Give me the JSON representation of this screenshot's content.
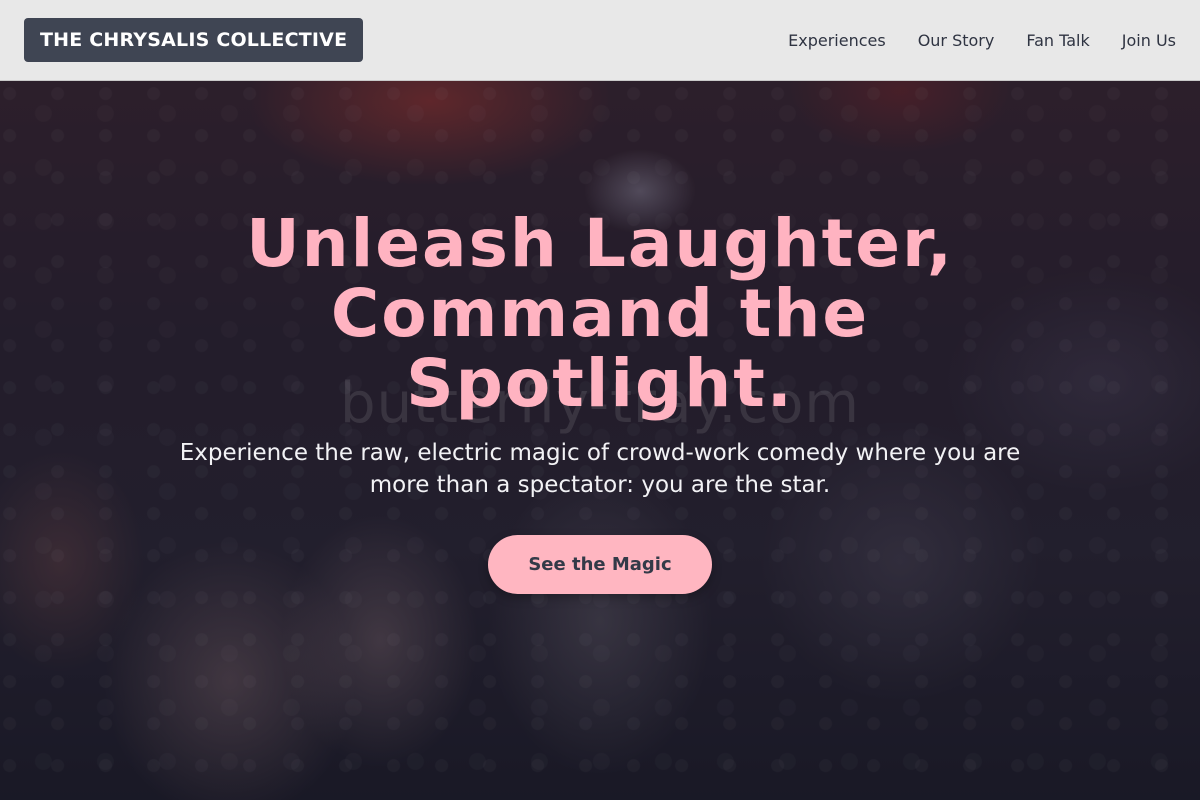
{
  "header": {
    "brand": "THE CHRYSALIS COLLECTIVE",
    "nav": [
      {
        "label": "Experiences"
      },
      {
        "label": "Our Story"
      },
      {
        "label": "Fan Talk"
      },
      {
        "label": "Join Us"
      }
    ]
  },
  "hero": {
    "watermark": "butterfly-tray.com",
    "headline": "Unleash Laughter, Command the Spotlight.",
    "subtext": "Experience the raw, electric magic of crowd-work comedy where you are more than a spectator: you are the star.",
    "cta_label": "See the Magic"
  },
  "colors": {
    "accent_pink": "#ffb6c1",
    "brand_bg": "#3f4553",
    "header_bg": "#e8e8e8"
  }
}
